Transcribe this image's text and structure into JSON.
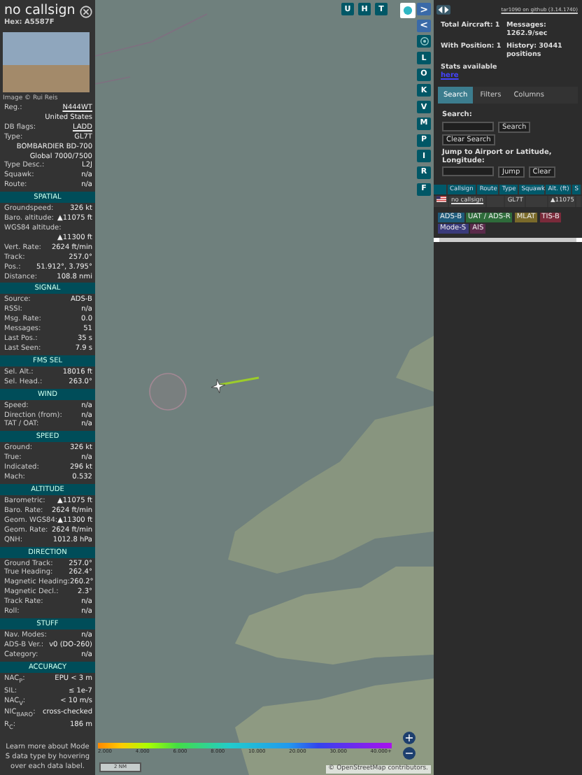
{
  "infoblock": {
    "callsign": "no callsign",
    "hex": "Hex: A5587F",
    "photo_credit": "Image © Rui Reis",
    "sections": [
      {
        "rows": [
          {
            "kind": "pair",
            "label": "Reg.:",
            "value": "N444WT",
            "link": true
          },
          {
            "kind": "value",
            "value": "United States"
          },
          {
            "kind": "pair",
            "label": "DB flags:",
            "value": "LADD",
            "link": true
          },
          {
            "kind": "pair",
            "label": "Type:",
            "value": "GL7T"
          },
          {
            "kind": "value",
            "value": "BOMBARDIER BD-700"
          },
          {
            "kind": "value",
            "value": "Global 7000/7500"
          },
          {
            "kind": "pair",
            "label": "Type Desc.:",
            "value": "L2J"
          },
          {
            "kind": "pair",
            "label": "Squawk:",
            "value": "n/a"
          },
          {
            "kind": "pair",
            "label": "Route:",
            "value": "n/a"
          }
        ]
      },
      {
        "title": "SPATIAL",
        "rows": [
          {
            "kind": "pair",
            "label": "Groundspeed:",
            "value": "326 kt"
          },
          {
            "kind": "pair",
            "label": "Baro. altitude:",
            "value": "▲11075 ft"
          },
          {
            "kind": "pair",
            "label": "WGS84 altitude:"
          },
          {
            "kind": "value",
            "value": "▲11300 ft"
          },
          {
            "kind": "pair",
            "label": "Vert. Rate:",
            "value": "2624 ft/min"
          },
          {
            "kind": "pair",
            "label": "Track:",
            "value": "257.0°"
          },
          {
            "kind": "pair",
            "label": "Pos.:",
            "value": "51.912°, 3.795°"
          },
          {
            "kind": "pair",
            "label": "Distance:",
            "value": "108.8 nmi"
          }
        ]
      },
      {
        "title": "SIGNAL",
        "rows": [
          {
            "kind": "pair",
            "label": "Source:",
            "value": "ADS-B"
          },
          {
            "kind": "pair",
            "label": "RSSI:",
            "value": "n/a"
          },
          {
            "kind": "pair",
            "label": "Msg. Rate:",
            "value": "0.0"
          },
          {
            "kind": "pair",
            "label": "Messages:",
            "value": "51"
          },
          {
            "kind": "pair",
            "label": "Last Pos.:",
            "value": "35 s"
          },
          {
            "kind": "pair",
            "label": "Last Seen:",
            "value": "7.9 s"
          }
        ]
      },
      {
        "title": "FMS SEL",
        "rows": [
          {
            "kind": "pair",
            "label": "Sel. Alt.:",
            "value": "18016 ft"
          },
          {
            "kind": "pair",
            "label": "Sel. Head.:",
            "value": "263.0°"
          }
        ]
      },
      {
        "title": "WIND",
        "rows": [
          {
            "kind": "pair",
            "label": "Speed:",
            "value": "n/a"
          },
          {
            "kind": "pair",
            "label": "Direction (from):",
            "value": "n/a"
          },
          {
            "kind": "pair",
            "label": "TAT / OAT:",
            "value": "n/a"
          }
        ]
      },
      {
        "title": "SPEED",
        "rows": [
          {
            "kind": "pair",
            "label": "Ground:",
            "value": "326 kt"
          },
          {
            "kind": "pair",
            "label": "True:",
            "value": "n/a"
          },
          {
            "kind": "pair",
            "label": "Indicated:",
            "value": "296 kt"
          },
          {
            "kind": "pair",
            "label": "Mach:",
            "value": "0.532"
          }
        ]
      },
      {
        "title": "ALTITUDE",
        "rows": [
          {
            "kind": "pair",
            "label": "Barometric:",
            "value": "▲11075 ft"
          },
          {
            "kind": "pair",
            "label": "Baro. Rate:",
            "value": "2624 ft/min"
          },
          {
            "kind": "pair",
            "label": "Geom. WGS84:",
            "value": "▲11300 ft"
          },
          {
            "kind": "pair",
            "label": "Geom. Rate:",
            "value": "2624 ft/min"
          },
          {
            "kind": "pair",
            "label": "QNH:",
            "value": "1012.8 hPa"
          }
        ]
      },
      {
        "title": "DIRECTION",
        "rows": [
          {
            "kind": "pair",
            "label": "Ground Track:",
            "value": "257.0°"
          },
          {
            "kind": "pair",
            "label": "True Heading:",
            "value": "262.4°"
          },
          {
            "kind": "pair",
            "label": "Magnetic Heading:",
            "value": "260.2°"
          },
          {
            "kind": "pair",
            "label": "Magnetic Decl.:",
            "value": "2.3°"
          },
          {
            "kind": "pair",
            "label": "Track Rate:",
            "value": "n/a"
          },
          {
            "kind": "pair",
            "label": "Roll:",
            "value": "n/a"
          }
        ]
      },
      {
        "title": "STUFF",
        "rows": [
          {
            "kind": "pair",
            "label": "Nav. Modes:",
            "value": "n/a"
          },
          {
            "kind": "pair",
            "label": "ADS-B Ver.:",
            "value": "v0 (DO-260)"
          },
          {
            "kind": "pair",
            "label": "Category:",
            "value": "n/a"
          }
        ]
      },
      {
        "title": "ACCURACY",
        "rows": [
          {
            "kind": "pair",
            "label": "NAC$_{P}$:",
            "value": "EPU < 3 m"
          },
          {
            "kind": "pair",
            "label": "SIL:",
            "value": "≤ 1e-7"
          },
          {
            "kind": "pair",
            "label": "NAC$_{V}$:",
            "value": "< 10 m/s"
          },
          {
            "kind": "pair",
            "label": "NIC$_{BARO}$:",
            "value": "cross-checked"
          },
          {
            "kind": "pair",
            "label": "R$_{C}$:",
            "value": "186 m"
          }
        ]
      }
    ],
    "footer": "Learn more about Mode S data type by hovering over each data label."
  },
  "map": {
    "top_buttons": [
      "U",
      "H",
      "T"
    ],
    "side_buttons": [
      {
        "kind": "icon",
        "label": ">"
      },
      {
        "kind": "icon",
        "label": "<"
      },
      {
        "kind": "gear"
      },
      {
        "kind": "letter",
        "label": "L"
      },
      {
        "kind": "letter",
        "label": "O"
      },
      {
        "kind": "letter",
        "label": "K"
      },
      {
        "kind": "letter",
        "label": "V"
      },
      {
        "kind": "letter",
        "label": "M"
      },
      {
        "kind": "letter",
        "label": "P"
      },
      {
        "kind": "letter",
        "label": "I"
      },
      {
        "kind": "letter",
        "label": "R"
      },
      {
        "kind": "letter",
        "label": "F"
      }
    ],
    "legend_ticks": [
      "2.000",
      "4.000",
      "6.000",
      "8.000",
      "10.000",
      "20.000",
      "30.000",
      "40.000+"
    ],
    "scale": "2 NM",
    "attribution": "© OpenStreetMap contributors.",
    "zoom": [
      "+",
      "−"
    ]
  },
  "sidebar": {
    "version_link": "tar1090 on github (3.14.1740)",
    "stats": [
      {
        "text": "Total Aircraft: 1"
      },
      {
        "text": "Messages: 1262.9/sec"
      },
      {
        "text": "With Position: 1"
      },
      {
        "text": "History: 30441 positions"
      }
    ],
    "stats_available": "Stats available",
    "stats_link": "here",
    "tabs": [
      {
        "label": "Search",
        "selected": true
      },
      {
        "label": "Filters",
        "selected": false
      },
      {
        "label": "Columns",
        "selected": false
      }
    ],
    "search_label": "Search:",
    "search_button": "Search",
    "clear_search": "Clear Search",
    "jump_label": "Jump to Airport or Latitude, Longitude:",
    "jump_button": "Jump",
    "clear_button": "Clear",
    "table": {
      "columns": [
        "Callsign",
        "Route",
        "Type",
        "Squawk",
        "Alt. (ft)",
        "S"
      ],
      "rows": [
        {
          "callsign": "no callsign",
          "type": "GL7T",
          "alt": "▲11075"
        }
      ]
    },
    "legend": [
      {
        "label": "ADS-B",
        "color": "#1e5a7a"
      },
      {
        "label": "UAT / ADS-R",
        "color": "#2e6b3a"
      },
      {
        "label": "MLAT",
        "color": "#7a6a2a"
      },
      {
        "label": "TIS-B",
        "color": "#7a2a3a"
      },
      {
        "label": "Mode-S",
        "color": "#3a3a7a"
      },
      {
        "label": "AIS",
        "color": "#5a2a4a"
      }
    ]
  }
}
